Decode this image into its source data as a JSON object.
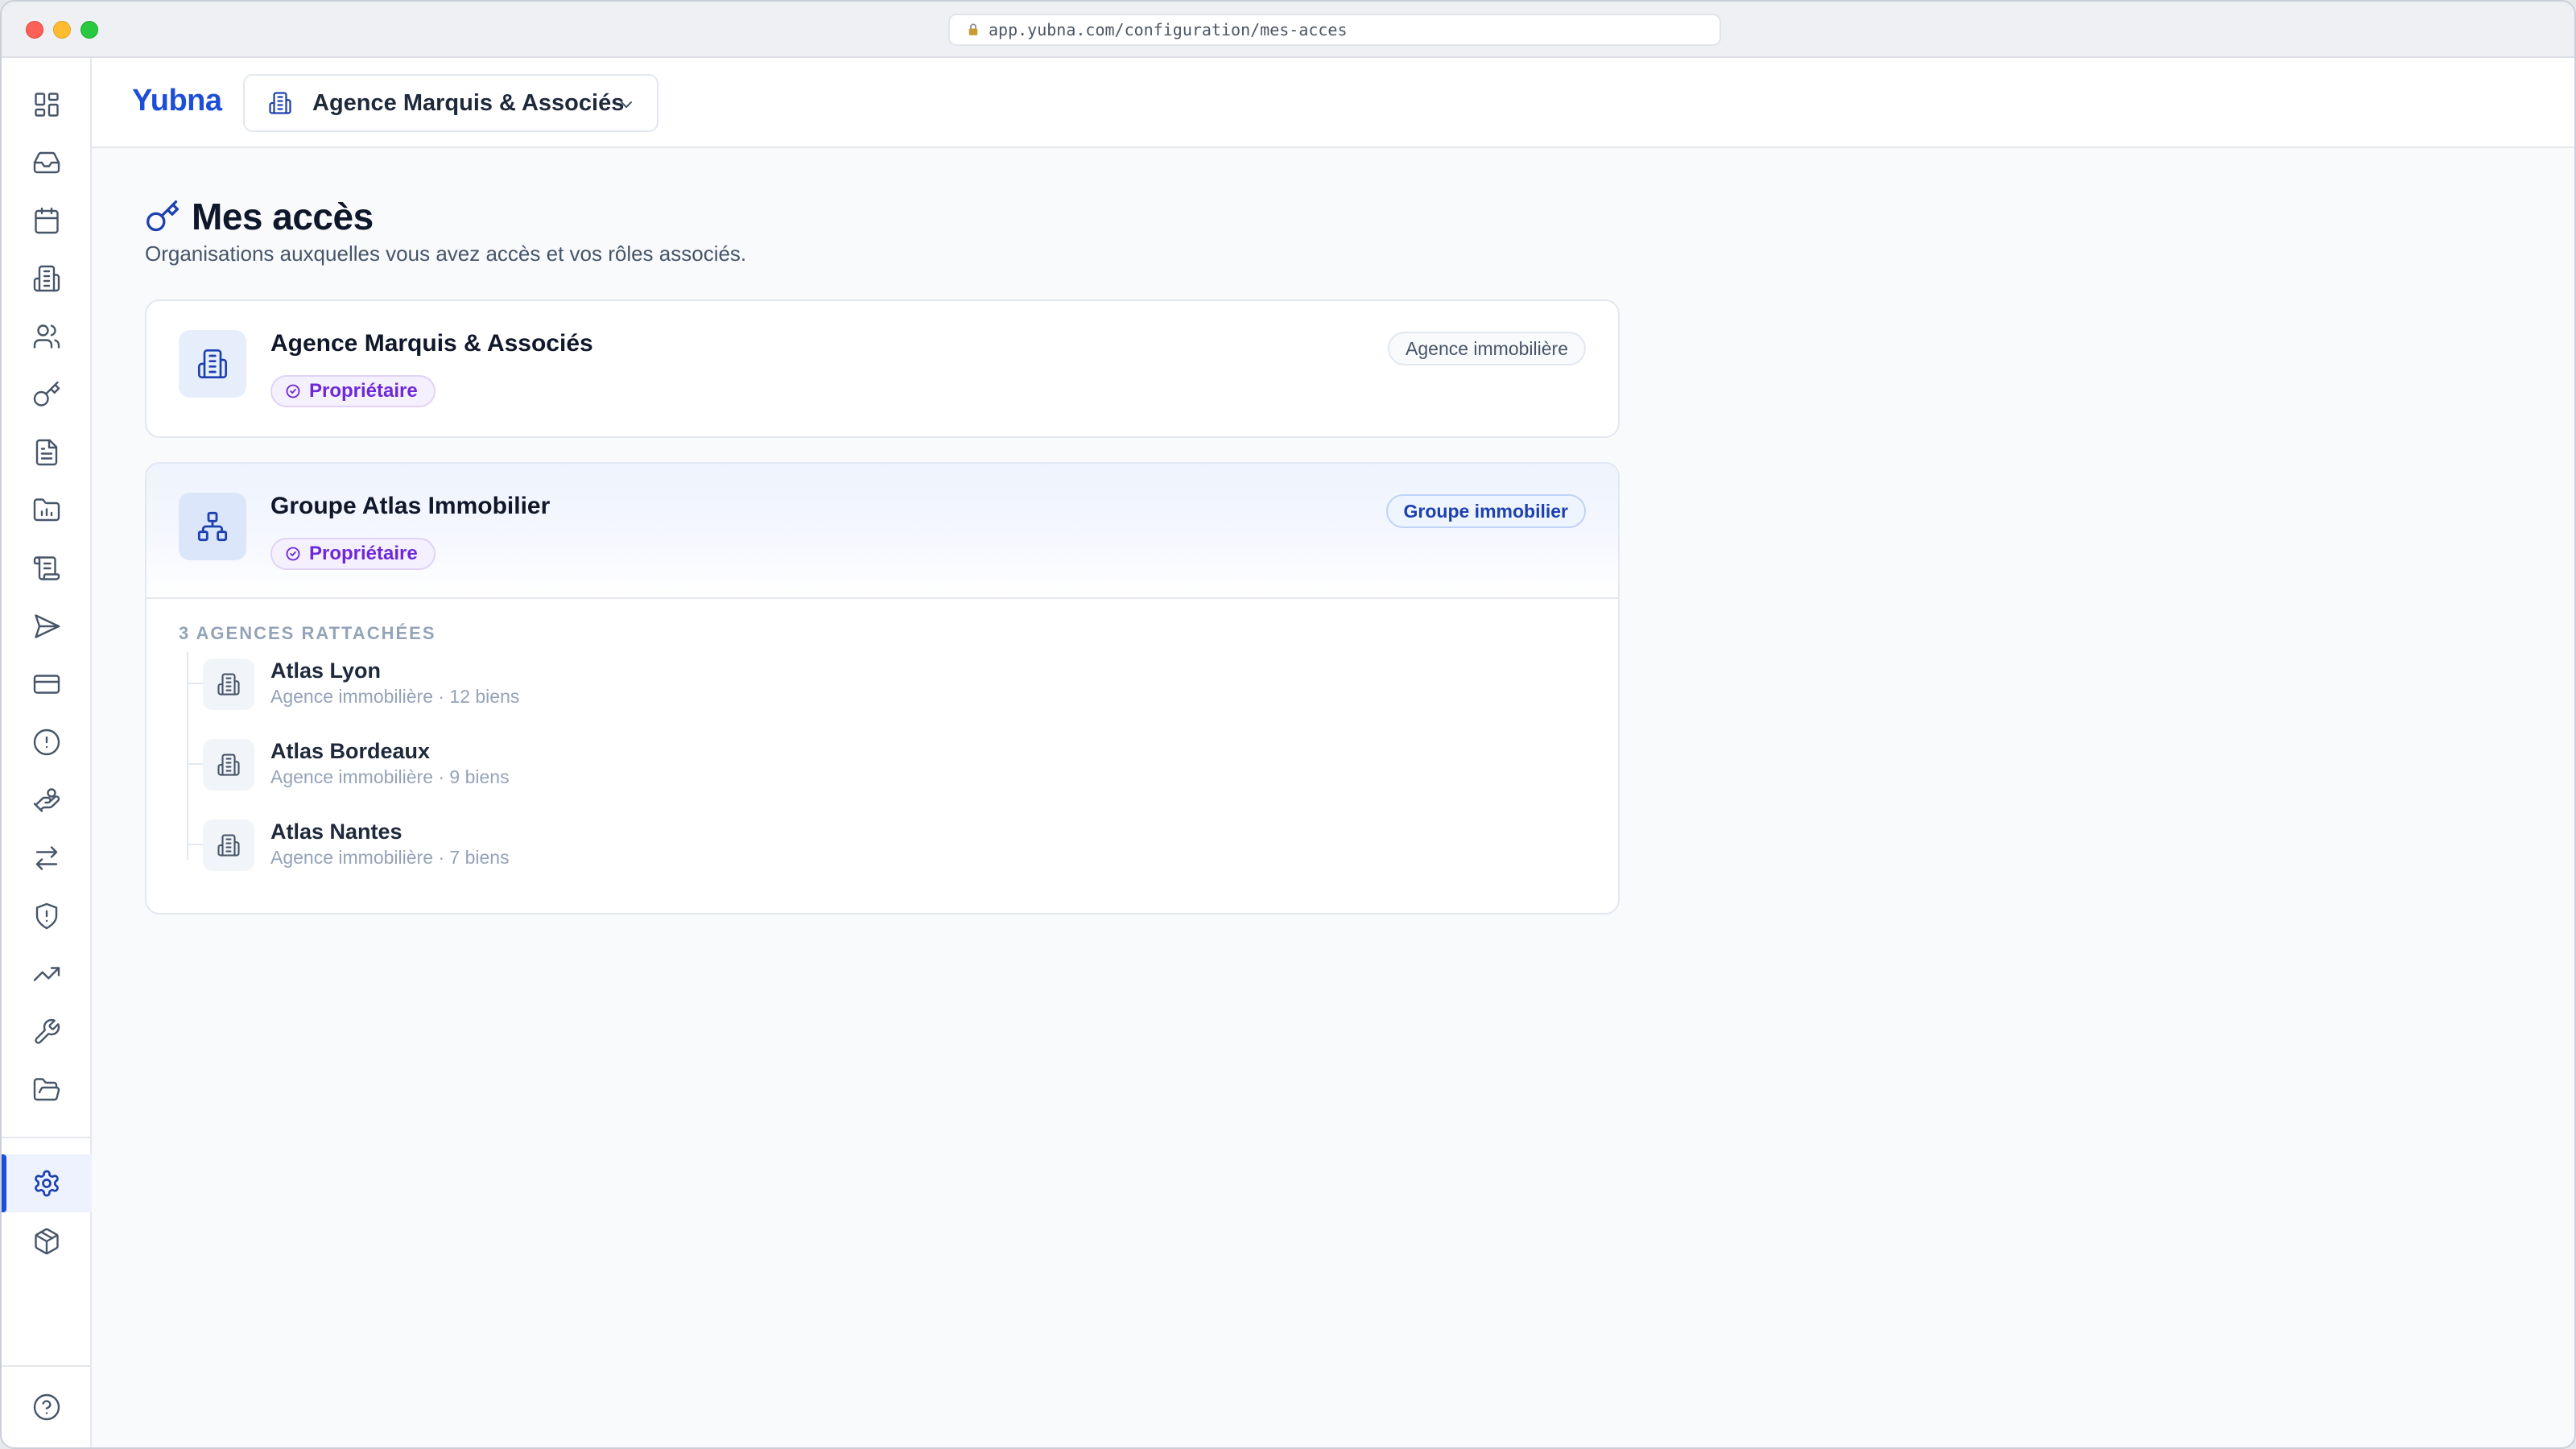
{
  "browser": {
    "url": "app.yubna.com/configuration/mes-acces"
  },
  "header": {
    "brand": "Yubna",
    "org_selector": "Agence Marquis & Associés"
  },
  "page": {
    "title": "Mes accès",
    "subtitle": "Organisations auxquelles vous avez accès et vos rôles associés."
  },
  "organizations": [
    {
      "name": "Agence Marquis & Associés",
      "role": "Propriétaire",
      "type": "Agence immobilière"
    },
    {
      "name": "Groupe Atlas Immobilier",
      "role": "Propriétaire",
      "type": "Groupe immobilier",
      "children_label": "3 AGENCES RATTACHÉES",
      "children": [
        {
          "name": "Atlas Lyon",
          "meta": "Agence immobilière · 12 biens"
        },
        {
          "name": "Atlas Bordeaux",
          "meta": "Agence immobilière · 9 biens"
        },
        {
          "name": "Atlas Nantes",
          "meta": "Agence immobilière · 7 biens"
        }
      ]
    }
  ],
  "sidebar": {
    "icons": [
      "dashboard-icon",
      "inbox-icon",
      "calendar-icon",
      "building-icon",
      "users-icon",
      "key-icon",
      "document-icon",
      "folder-chart-icon",
      "scroll-icon",
      "send-icon",
      "credit-card-icon",
      "alert-circle-icon",
      "handshake-icon",
      "transfer-icon",
      "shield-alert-icon",
      "trending-up-icon",
      "wrench-icon",
      "folder-open-icon",
      "settings-icon",
      "package-icon",
      "help-icon"
    ],
    "active": "settings-icon"
  },
  "colors": {
    "accent": "#1d4ed8",
    "role_badge": "#6d28d9",
    "background": "#f8fafc"
  }
}
